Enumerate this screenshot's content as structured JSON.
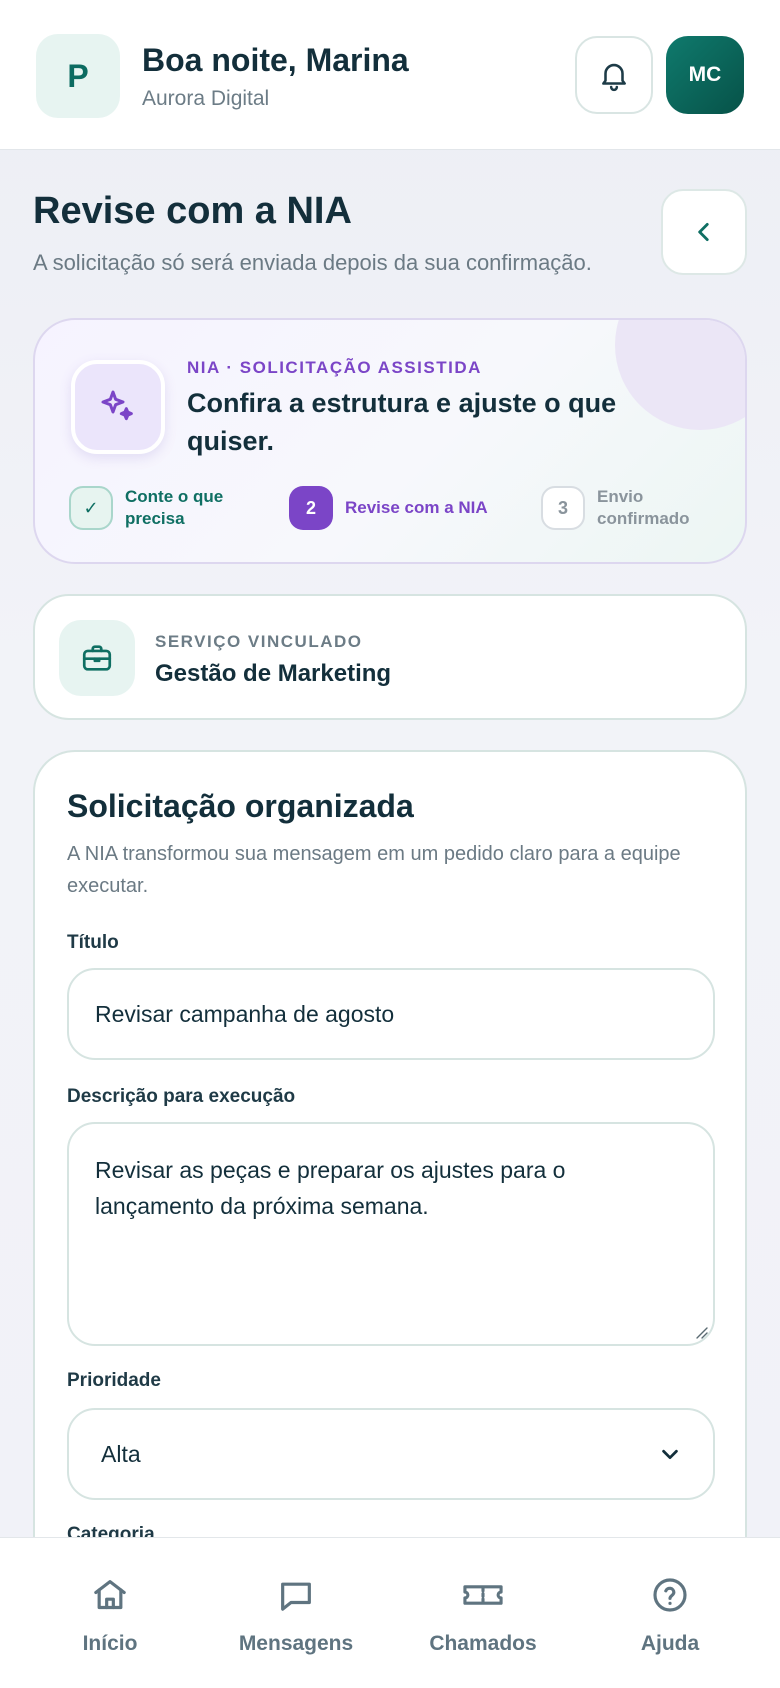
{
  "header": {
    "logo_letter": "P",
    "greeting": "Boa noite, Marina",
    "company": "Aurora Digital",
    "notifications_icon": "bell-icon",
    "avatar_initials": "MC"
  },
  "page": {
    "title": "Revise com a NIA",
    "subtitle": "A solicitação só será enviada depois da sua confirmação.",
    "back_icon": "chevron-left-icon"
  },
  "nia_card": {
    "icon": "sparkles-icon",
    "eyebrow": "NIA · SOLICITAÇÃO ASSISTIDA",
    "headline": "Confira a estrutura e ajuste o que quiser.",
    "steps": [
      {
        "badge": "✓",
        "label": "Conte o que precisa",
        "state": "done"
      },
      {
        "badge": "2",
        "label": "Revise com a NIA",
        "state": "active"
      },
      {
        "badge": "3",
        "label": "Envio confirmado",
        "state": "todo"
      }
    ]
  },
  "service": {
    "icon": "briefcase-icon",
    "eyebrow": "SERVIÇO VINCULADO",
    "name": "Gestão de Marketing"
  },
  "form": {
    "title": "Solicitação organizada",
    "subtitle": "A NIA transformou sua mensagem em um pedido claro para a equipe executar.",
    "title_label": "Título",
    "title_value": "Revisar campanha de agosto",
    "description_label": "Descrição para execução",
    "description_value": "Revisar as peças e preparar os ajustes para o lançamento da próxima semana.",
    "priority_label": "Prioridade",
    "priority_value": "Alta",
    "category_label": "Categoria"
  },
  "nav": {
    "items": [
      {
        "label": "Início",
        "icon": "home-icon"
      },
      {
        "label": "Mensagens",
        "icon": "chat-icon"
      },
      {
        "label": "Chamados",
        "icon": "ticket-icon"
      },
      {
        "label": "Ajuda",
        "icon": "help-icon"
      }
    ]
  },
  "colors": {
    "brand": "#0c6b61",
    "accent_purple": "#7b45c7",
    "text_dark": "#132f3b"
  }
}
